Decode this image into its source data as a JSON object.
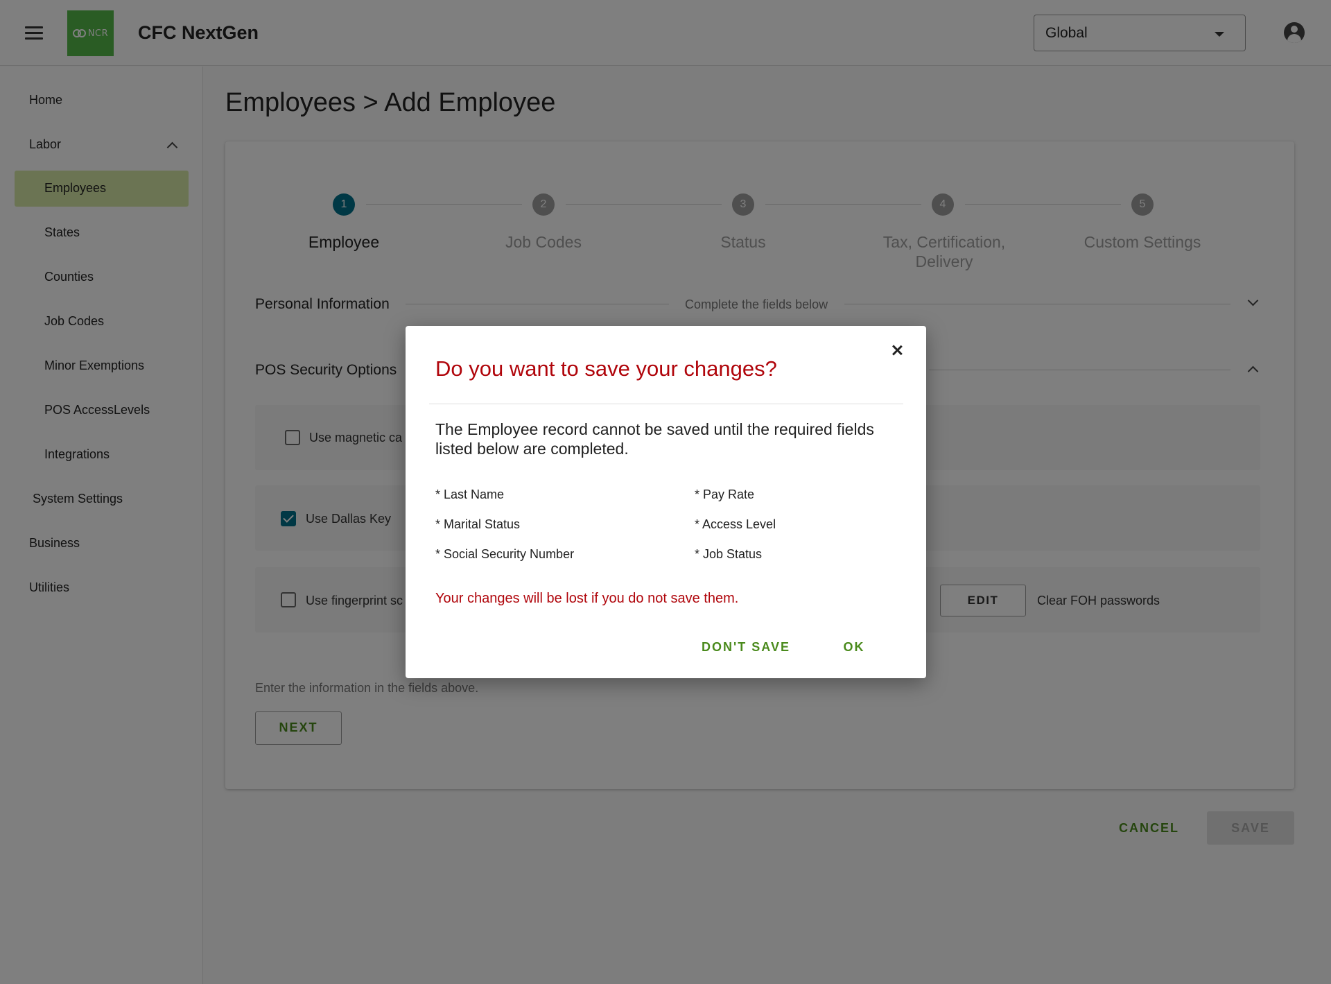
{
  "header": {
    "app_title": "CFC NextGen",
    "logo_text": "NCR",
    "scope_select": {
      "value": "Global"
    },
    "logo_color": "#54b948"
  },
  "sidebar": {
    "items": [
      {
        "label": "Home"
      },
      {
        "label": "Labor"
      },
      {
        "label": "Employees"
      },
      {
        "label": "States"
      },
      {
        "label": "Counties"
      },
      {
        "label": "Job Codes"
      },
      {
        "label": "Minor Exemptions"
      },
      {
        "label": "POS AccessLevels"
      },
      {
        "label": "Integrations"
      },
      {
        "label": "System Settings"
      },
      {
        "label": "Business"
      },
      {
        "label": "Utilities"
      }
    ],
    "active_item": "Employees",
    "active_color": "#d7e9a7"
  },
  "main": {
    "page_title": "Employees > Add Employee",
    "stepper": [
      {
        "number": "1",
        "label": "Employee",
        "active": true
      },
      {
        "number": "2",
        "label": "Job Codes",
        "active": false
      },
      {
        "number": "3",
        "label": "Status",
        "active": false
      },
      {
        "number": "4",
        "label_line1": "Tax, Certification,",
        "label_line2": "Delivery",
        "active": false
      },
      {
        "number": "5",
        "label": "Custom Settings",
        "active": false
      }
    ],
    "personal_info": {
      "title": "Personal Information",
      "subtitle": "Complete the fields below"
    },
    "pos_security": {
      "title": "POS Security Options",
      "options": [
        {
          "label": "Use magnetic ca",
          "checked": false
        },
        {
          "label": "Use Dallas Key",
          "checked": true
        },
        {
          "label": "Use fingerprint sc",
          "checked": false
        }
      ],
      "edit_label": "EDIT",
      "clear_foh_label": "Clear FOH passwords"
    },
    "hint": "Enter the information in the fields above.",
    "next_label": "NEXT",
    "cancel_label": "CANCEL",
    "save_label": "SAVE"
  },
  "dialog": {
    "title": "Do you want to save your changes?",
    "message": "The Employee record cannot be saved until the required fields listed below are completed.",
    "required_fields": [
      "* Last Name",
      "* Marital Status",
      "* Social Security Number",
      "* Pay Rate",
      "* Access Level",
      "* Job Status"
    ],
    "warning": "Your changes will be lost if you do not save them.",
    "dont_save_label": "DON'T SAVE",
    "ok_label": "OK",
    "title_color": "#b0050b",
    "button_color": "#4a8a1c"
  }
}
